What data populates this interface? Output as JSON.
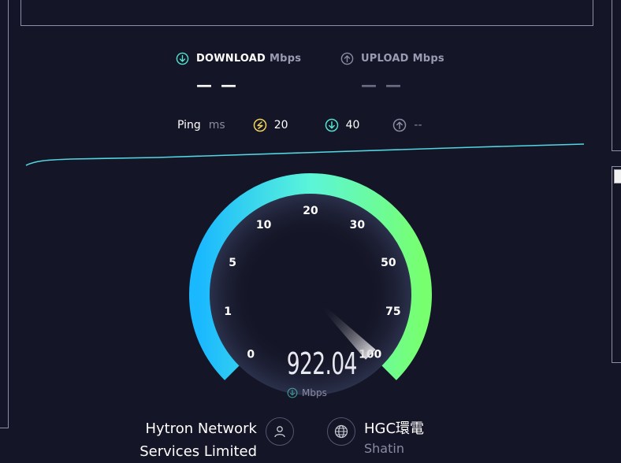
{
  "download": {
    "label": "DOWNLOAD",
    "unit": "Mbps",
    "value": "— —",
    "icon": "download-arrow-icon"
  },
  "upload": {
    "label": "UPLOAD",
    "unit": "Mbps",
    "value": "— —",
    "icon": "upload-arrow-icon"
  },
  "ping": {
    "label": "Ping",
    "unit": "ms",
    "idle": "20",
    "download": "40",
    "upload": "--"
  },
  "gauge": {
    "ticks": [
      "0",
      "1",
      "5",
      "10",
      "20",
      "30",
      "50",
      "75",
      "100"
    ],
    "current_value": "922.04",
    "unit": "Mbps",
    "needle_fraction": 1.0
  },
  "provider": {
    "name_line1": "Hytron Network",
    "name_line2": "Services Limited",
    "icon": "user-icon"
  },
  "server": {
    "name": "HGC環電",
    "location": "Shatin",
    "icon": "globe-icon"
  },
  "colors": {
    "background": "#141526",
    "gauge_start": "#1ab8ff",
    "gauge_mid": "#5bf5d9",
    "gauge_end": "#77ff70",
    "ping_idle": "#f2d45c",
    "download_accent": "#53e2d0",
    "muted": "#8a8ba0"
  }
}
